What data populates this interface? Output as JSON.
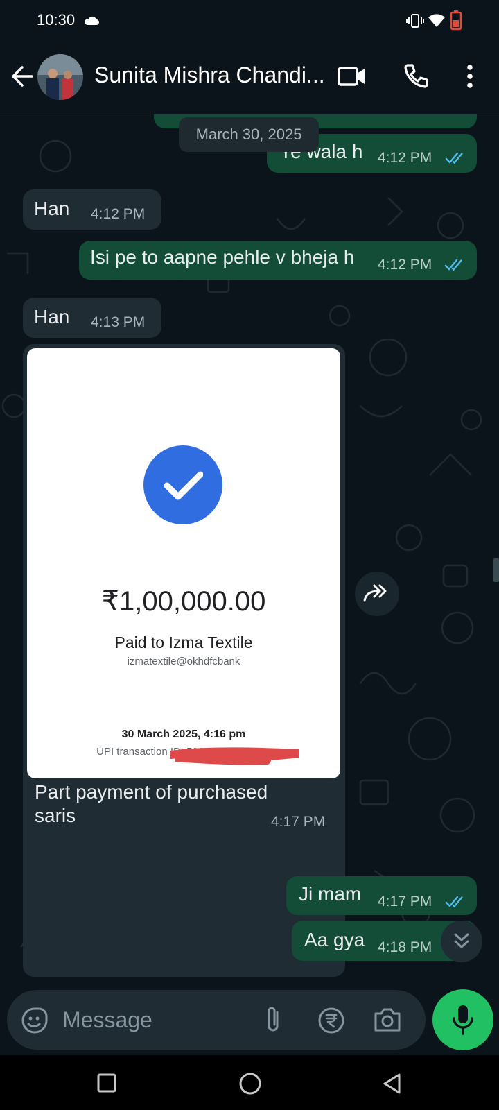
{
  "status_bar": {
    "time": "10:30",
    "icons": [
      "cloud-icon",
      "vibrate-icon",
      "wifi-icon",
      "battery-icon"
    ]
  },
  "header": {
    "contact_name": "Sunita Mishra Chandi...",
    "icons": [
      "back-arrow-icon",
      "video-call-icon",
      "phone-icon",
      "more-vert-icon"
    ]
  },
  "chat": {
    "date_chip": "March 30, 2025",
    "messages": [
      {
        "direction": "outgoing",
        "text": "Ye wala h",
        "time": "4:12 PM",
        "status": "read"
      },
      {
        "direction": "incoming",
        "text": "Han",
        "time": "4:12 PM"
      },
      {
        "direction": "outgoing",
        "text": "Isi pe to aapne pehle v bheja h",
        "time": "4:12 PM",
        "status": "read"
      },
      {
        "direction": "incoming",
        "text": "Han",
        "time": "4:13 PM"
      },
      {
        "direction": "incoming",
        "type": "image",
        "image": {
          "amount": "₹1,00,000.00",
          "paid_to": "Paid to Izma Textile",
          "upi_id": "izmatextile@okhdfcbank",
          "datetime": "30 March 2025, 4:16 pm",
          "transaction": "UPI transaction ID: 50892"
        },
        "caption": "Part payment of purchased saris",
        "caption_line1": "Part payment of purchased",
        "caption_line2": "saris",
        "time": "4:17 PM"
      },
      {
        "direction": "outgoing",
        "text": "Ji mam",
        "time": "4:17 PM",
        "status": "read"
      },
      {
        "direction": "outgoing",
        "text": "Aa gya",
        "time": "4:18 PM",
        "status": "sent"
      }
    ]
  },
  "composer": {
    "placeholder": "Message",
    "icons": [
      "emoji-sticker-icon",
      "attach-icon",
      "rupee-payment-icon",
      "camera-icon",
      "mic-icon"
    ]
  },
  "colors": {
    "background": "#0b141a",
    "outgoing_bubble": "#134d37",
    "incoming_bubble": "#202c33",
    "read_ticks": "#53bdeb",
    "mic_button": "#21c063",
    "check_circle": "#2f6de1"
  }
}
